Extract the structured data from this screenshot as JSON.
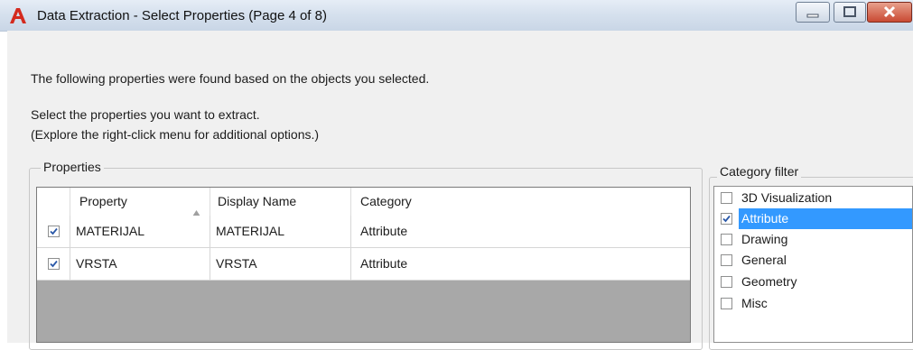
{
  "window": {
    "title": "Data Extraction - Select Properties (Page 4 of 8)",
    "logo_icon": "autocad-a-icon",
    "accent_color": "#d42a1e"
  },
  "intro": {
    "line1": "The following properties were found based on the objects you selected.",
    "line2": "Select the properties you want to extract.",
    "line3": "(Explore the right-click menu for additional options.)"
  },
  "properties": {
    "group_label": "Properties",
    "columns": [
      "Property",
      "Display Name",
      "Category"
    ],
    "sort_icon": "sort-ascending-icon",
    "rows": [
      {
        "checked": true,
        "property": "MATERIJAL",
        "display_name": "MATERIJAL",
        "category": "Attribute"
      },
      {
        "checked": true,
        "property": "VRSTA",
        "display_name": "VRSTA",
        "category": "Attribute"
      }
    ]
  },
  "category_filter": {
    "group_label": "Category filter",
    "items": [
      {
        "label": "3D Visualization",
        "checked": false,
        "selected": false
      },
      {
        "label": "Attribute",
        "checked": true,
        "selected": true
      },
      {
        "label": "Drawing",
        "checked": false,
        "selected": false
      },
      {
        "label": "General",
        "checked": false,
        "selected": false
      },
      {
        "label": "Geometry",
        "checked": false,
        "selected": false
      },
      {
        "label": "Misc",
        "checked": false,
        "selected": false
      }
    ],
    "selection_color": "#3399ff"
  }
}
